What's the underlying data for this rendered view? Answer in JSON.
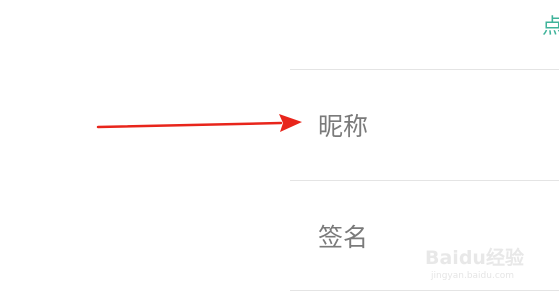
{
  "header": {
    "action_label": "点"
  },
  "rows": [
    {
      "label": "昵称"
    },
    {
      "label": "签名"
    }
  ],
  "annotation": {
    "arrow_color": "#e8251b"
  },
  "watermark": {
    "brand": "Baidu经验",
    "url": "jingyan.baidu.com"
  },
  "colors": {
    "accent": "#3fb39a",
    "label": "#7a7a7a",
    "divider": "#e4e4e4"
  }
}
